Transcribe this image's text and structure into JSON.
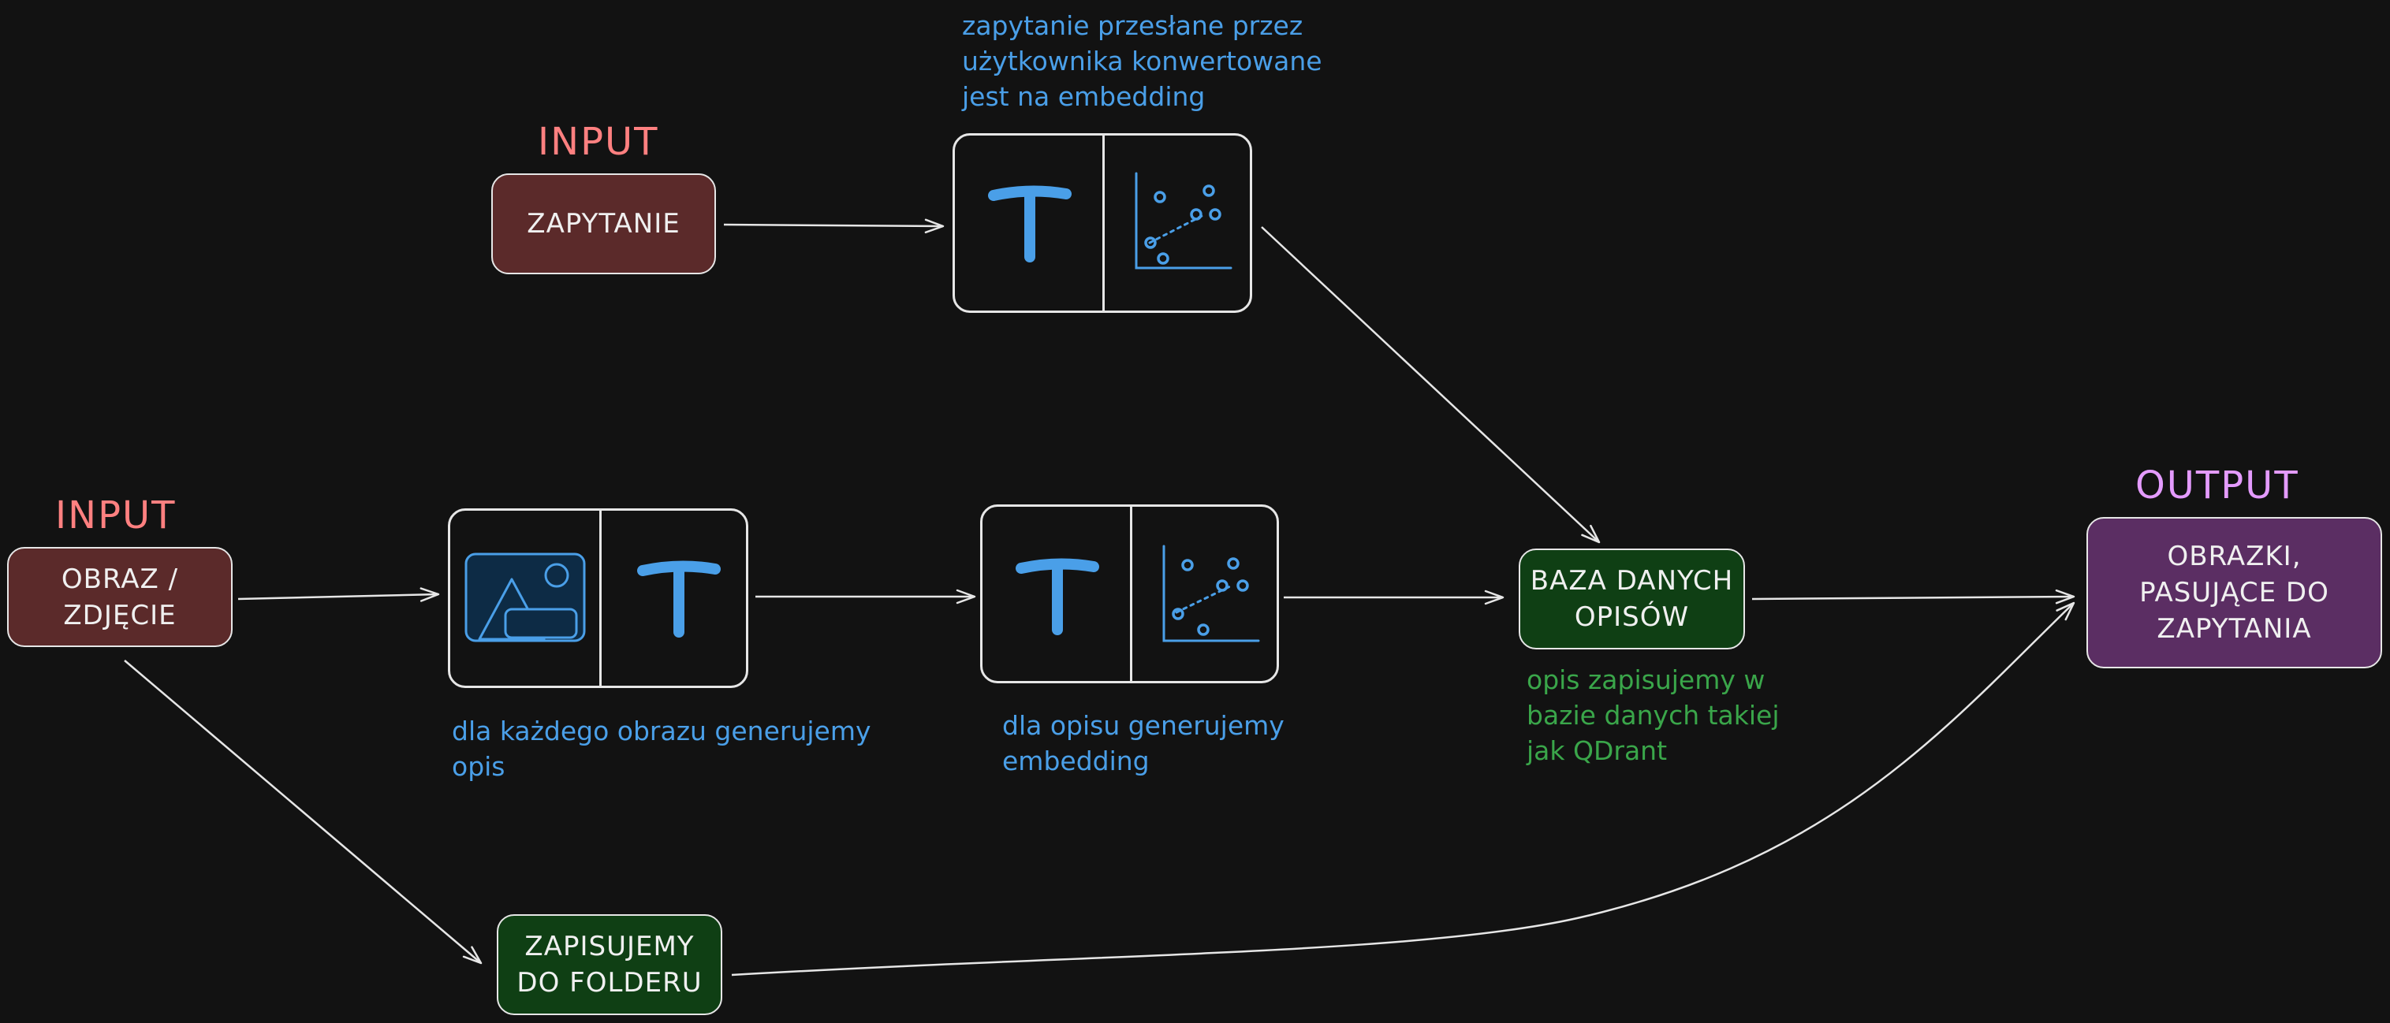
{
  "colors": {
    "background": "#121212",
    "input_box": "#5b2a2a",
    "db_box": "#0f3f14",
    "output_box": "#5b2e63",
    "input_label": "#ff8080",
    "output_label": "#e49bff",
    "blue_note": "#4a9fe8",
    "green_note": "#3aa64a",
    "stroke": "#e6e6e6"
  },
  "labels": {
    "input_top": "INPUT",
    "input_left": "INPUT",
    "output": "OUTPUT"
  },
  "nodes": {
    "query": "ZAPYTANIE",
    "image": "OBRAZ /\nZDJĘCIE",
    "database": "BAZA DANYCH\nOPISÓW",
    "folder": "ZAPISUJEMY\nDO FOLDERU",
    "result": "OBRAZKI,\nPASUJĄCE DO\nZAPYTANIA"
  },
  "notes": {
    "query_embedding": "zapytanie przesłane przez\nużytkownika konwertowane\njest na embedding",
    "image_description": "dla każdego obrazu generujemy\nopis",
    "description_embedding": "dla opisu generujemy\nembedding",
    "database": "opis zapisujemy w\nbazie danych takiej\njak QDrant"
  },
  "icons": {
    "query_text": "text-icon",
    "query_scatter": "scatter-plot-icon",
    "image_picture": "image-icon",
    "image_text": "text-icon",
    "desc_text": "text-icon",
    "desc_scatter": "scatter-plot-icon"
  }
}
